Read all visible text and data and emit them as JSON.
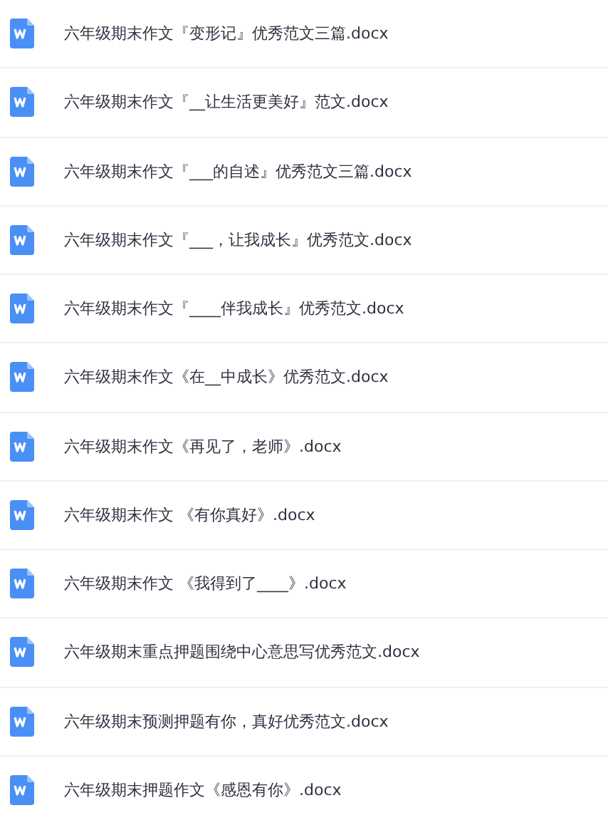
{
  "files": [
    {
      "name": "六年级期末作文『变形记』优秀范文三篇.docx"
    },
    {
      "name": "六年级期末作文『__让生活更美好』范文.docx"
    },
    {
      "name": "六年级期末作文『___的自述』优秀范文三篇.docx"
    },
    {
      "name": "六年级期末作文『___，让我成长』优秀范文.docx"
    },
    {
      "name": "六年级期末作文『____伴我成长』优秀范文.docx"
    },
    {
      "name": "六年级期末作文《在__中成长》优秀范文.docx"
    },
    {
      "name": "六年级期末作文《再见了，老师》.docx"
    },
    {
      "name": "六年级期末作文 《有你真好》.docx"
    },
    {
      "name": "六年级期末作文 《我得到了____》.docx"
    },
    {
      "name": "六年级期末重点押题围绕中心意思写优秀范文.docx"
    },
    {
      "name": "六年级期末预测押题有你，真好优秀范文.docx"
    },
    {
      "name": "六年级期末押题作文《感恩有你》.docx"
    }
  ]
}
